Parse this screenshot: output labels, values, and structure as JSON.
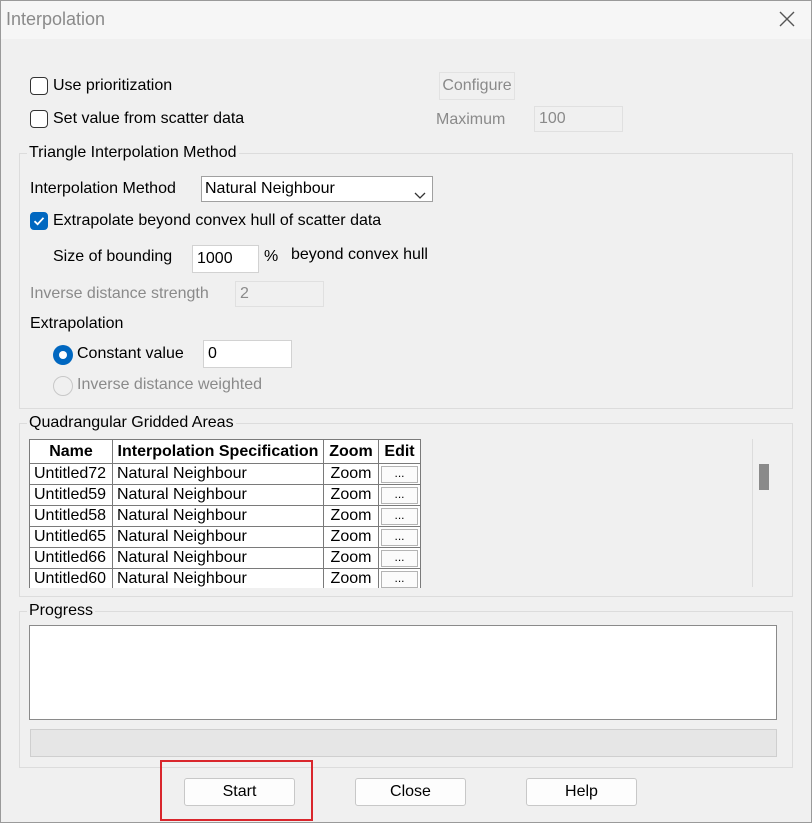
{
  "window": {
    "title": "Interpolation"
  },
  "options": {
    "use_prioritization": {
      "label": "Use prioritization",
      "checked": false
    },
    "configure_label": "Configure",
    "set_value": {
      "label": "Set value from scatter data",
      "checked": false
    },
    "maximum_label": "Maximum",
    "maximum_value": "100"
  },
  "triangle": {
    "title": "Triangle Interpolation Method",
    "method_label": "Interpolation Method",
    "method_value": "Natural Neighbour",
    "extrapolate": {
      "label": "Extrapolate beyond convex hull of scatter data",
      "checked": true
    },
    "bounding_label": "Size of bounding",
    "bounding_value": "1000",
    "percent": "%",
    "beyond_label": "beyond convex hull",
    "idw_strength_label": "Inverse distance strength",
    "idw_strength_value": "2",
    "extrapolation_label": "Extrapolation",
    "constant_label": "Constant value",
    "constant_value": "0",
    "idw_label": "Inverse distance weighted"
  },
  "quad": {
    "title": "Quadrangular Gridded Areas",
    "columns": [
      "Name",
      "Interpolation Specification",
      "Zoom",
      "Edit"
    ],
    "rows": [
      {
        "name": "Untitled72",
        "spec": "Natural Neighbour",
        "zoom": "Zoom",
        "edit": "..."
      },
      {
        "name": "Untitled59",
        "spec": "Natural Neighbour",
        "zoom": "Zoom",
        "edit": "..."
      },
      {
        "name": "Untitled58",
        "spec": "Natural Neighbour",
        "zoom": "Zoom",
        "edit": "..."
      },
      {
        "name": "Untitled65",
        "spec": "Natural Neighbour",
        "zoom": "Zoom",
        "edit": "..."
      },
      {
        "name": "Untitled66",
        "spec": "Natural Neighbour",
        "zoom": "Zoom",
        "edit": "..."
      },
      {
        "name": "Untitled60",
        "spec": "Natural Neighbour",
        "zoom": "Zoom",
        "edit": "..."
      }
    ]
  },
  "progress": {
    "title": "Progress",
    "value": 0
  },
  "buttons": {
    "start": "Start",
    "close": "Close",
    "help": "Help"
  },
  "colors": {
    "accent": "#0067c0",
    "highlight": "#d9262c"
  },
  "icons": {
    "close": "close-icon",
    "check": "check-icon",
    "dropdown": "chevron-down-icon"
  }
}
